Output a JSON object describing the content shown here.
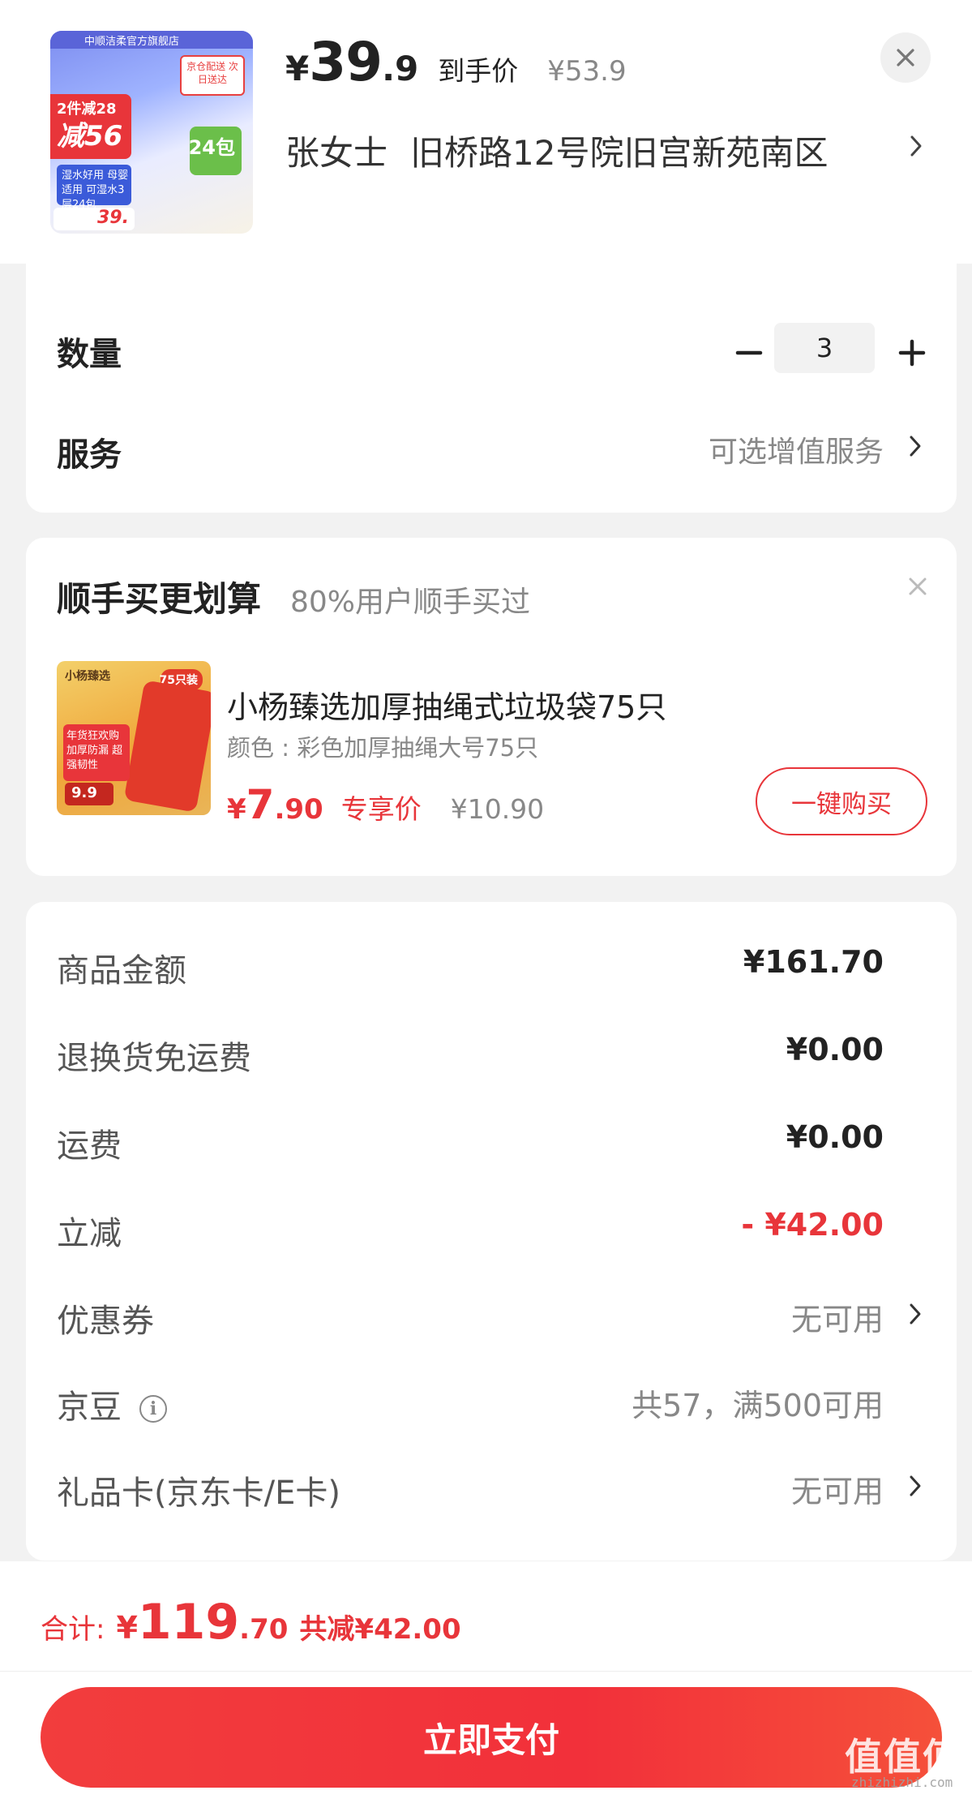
{
  "product": {
    "thumb": {
      "brand": "中顺洁柔官方旗舰店",
      "promo_line1": "2件减28",
      "promo_line2": "减56",
      "badge": "24包",
      "feature": "湿水好用 母婴适用 可湿水3层24包",
      "price": "39.",
      "stamp": "京仓配送 次日送达"
    },
    "price_yen": "¥",
    "price_int": "39",
    "price_dec": ".9",
    "price_tag": "到手价",
    "orig_price": "¥53.9",
    "recipient": "张女士",
    "address": "旧桥路12号院旧宫新苑南区"
  },
  "options": {
    "quantity_label": "数量",
    "quantity_value": "3",
    "service_label": "服务",
    "service_value": "可选增值服务"
  },
  "bundle": {
    "title": "顺手买更划算",
    "subtitle": "80%用户顺手买过",
    "item": {
      "thumb_logo": "小杨臻选",
      "thumb_badge": "75只装",
      "thumb_label": "年货狂欢购 加厚防漏 超强韧性",
      "thumb_price": "9.9",
      "name": "小杨臻选加厚抽绳式垃圾袋75只",
      "spec": "颜色 : 彩色加厚抽绳大号75只",
      "price_yen": "¥",
      "price_int": "7",
      "price_dec": ".90",
      "price_tag": "专享价",
      "orig_price": "¥10.90",
      "buy_label": "一键购买"
    }
  },
  "fees": [
    {
      "label": "商品金额",
      "value": "¥161.70"
    },
    {
      "label": "退换货免运费",
      "value": "¥0.00"
    },
    {
      "label": "运费",
      "value": "¥0.00"
    },
    {
      "label": "立减",
      "value": "- ¥42.00"
    },
    {
      "label": "优惠券",
      "value": "无可用"
    },
    {
      "label": "京豆",
      "value": "共57，满500可用"
    },
    {
      "label": "礼品卡(京东卡/E卡)",
      "value": "无可用"
    }
  ],
  "footer": {
    "total_label": "合计:",
    "total_yen": "¥",
    "total_int": "119",
    "total_dec": ".70",
    "total_saving": "共减¥42.00",
    "pay_label": "立即支付",
    "watermark": "值值值",
    "watermark_url": "zhizhizhi.com"
  },
  "colors": {
    "accent": "#e8353a",
    "background": "#f2f2f2"
  },
  "icons": [
    "close-icon",
    "chevron-right-icon",
    "minus-icon",
    "plus-icon",
    "info-icon"
  ]
}
